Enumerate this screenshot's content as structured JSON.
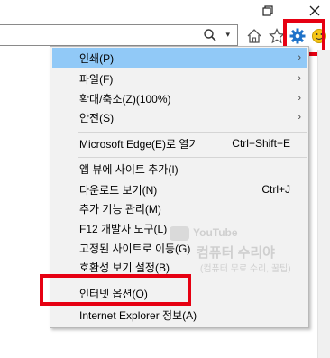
{
  "toolbar": {
    "restore_icon": "restore-icon",
    "close_icon": "close-icon",
    "search_dropdown": "▾"
  },
  "menu": {
    "items": [
      {
        "label": "인쇄(P)",
        "shortcut": "",
        "submenu": true,
        "highlighted": true
      },
      {
        "label": "파일(F)",
        "shortcut": "",
        "submenu": true
      },
      {
        "label": "확대/축소(Z)(100%)",
        "shortcut": "",
        "submenu": true
      },
      {
        "label": "안전(S)",
        "shortcut": "",
        "submenu": true
      },
      {
        "label": "Microsoft Edge(E)로 열기",
        "shortcut": "Ctrl+Shift+E",
        "submenu": false
      },
      {
        "label": "앱 뷰에 사이트 추가(I)",
        "shortcut": "",
        "submenu": false
      },
      {
        "label": "다운로드 보기(N)",
        "shortcut": "Ctrl+J",
        "submenu": false
      },
      {
        "label": "추가 기능 관리(M)",
        "shortcut": "",
        "submenu": false
      },
      {
        "label": "F12 개발자 도구(L)",
        "shortcut": "",
        "submenu": false
      },
      {
        "label": "고정된 사이트로 이동(G)",
        "shortcut": "",
        "submenu": false
      },
      {
        "label": "호환성 보기 설정(B)",
        "shortcut": "",
        "submenu": false
      },
      {
        "label": "인터넷 옵션(O)",
        "shortcut": "",
        "submenu": false
      },
      {
        "label": "Internet Explorer 정보(A)",
        "shortcut": "",
        "submenu": false
      }
    ]
  },
  "watermark": {
    "brand": "YouTube",
    "title": "컴퓨터 수리야",
    "subtitle": "(컴퓨터 무료 수리, 꿀팁)"
  },
  "colors": {
    "highlight": "#91c9f7",
    "annotation_red": "#e60012",
    "gear_blue": "#1f73c9",
    "smile_yellow": "#f5c518"
  }
}
